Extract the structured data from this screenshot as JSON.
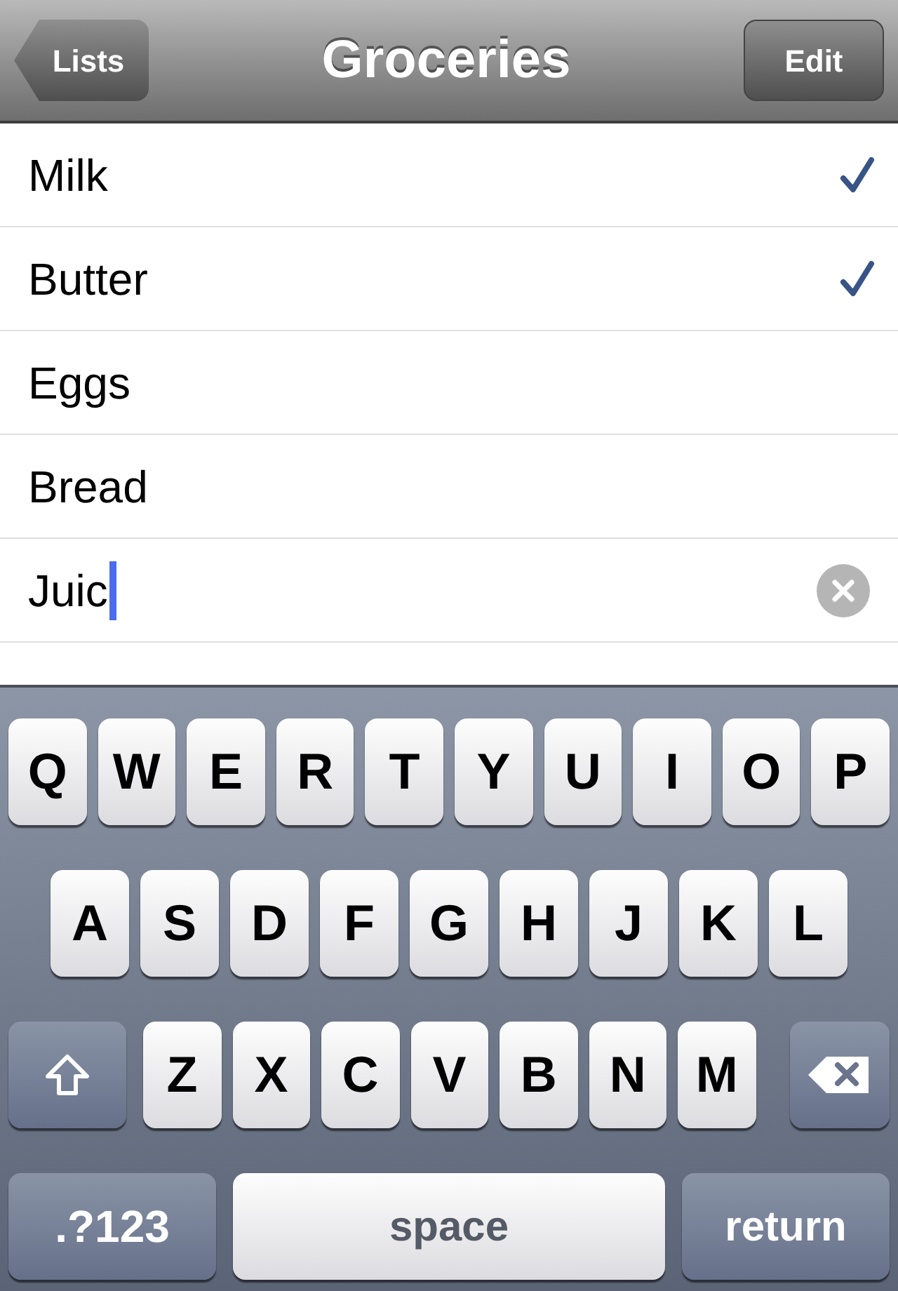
{
  "nav_bar": {
    "back_button": "Lists",
    "title": "Groceries",
    "edit_button": "Edit"
  },
  "items": [
    {
      "kind": "item",
      "text": "Milk",
      "checked": true
    },
    {
      "kind": "item",
      "text": "Butter",
      "checked": true
    },
    {
      "kind": "item",
      "text": "Eggs",
      "checked": false
    },
    {
      "kind": "item",
      "text": "Bread",
      "checked": false
    },
    {
      "kind": "field",
      "value": "Juic"
    }
  ],
  "keyboard": {
    "shift_key": {
      "kind": "shift"
    },
    "delete_key": {
      "kind": "delete"
    },
    "bottom_row": {
      "mode_key": ".?123",
      "space_key": "space",
      "return_key": "return"
    },
    "rows": [
      [
        {
          "kind": "letter",
          "label": "Q"
        },
        {
          "kind": "letter",
          "label": "W"
        },
        {
          "kind": "letter",
          "label": "E"
        },
        {
          "kind": "letter",
          "label": "R"
        },
        {
          "kind": "letter",
          "label": "T"
        },
        {
          "kind": "letter",
          "label": "Y"
        },
        {
          "kind": "letter",
          "label": "U"
        },
        {
          "kind": "letter",
          "label": "I"
        },
        {
          "kind": "letter",
          "label": "O"
        },
        {
          "kind": "letter",
          "label": "P"
        }
      ],
      [
        {
          "kind": "letter",
          "label": "A"
        },
        {
          "kind": "letter",
          "label": "S"
        },
        {
          "kind": "letter",
          "label": "D"
        },
        {
          "kind": "letter",
          "label": "F"
        },
        {
          "kind": "letter",
          "label": "G"
        },
        {
          "kind": "letter",
          "label": "H"
        },
        {
          "kind": "letter",
          "label": "J"
        },
        {
          "kind": "letter",
          "label": "K"
        },
        {
          "kind": "letter",
          "label": "L"
        }
      ],
      [
        {
          "kind": "letter",
          "label": "Z"
        },
        {
          "kind": "letter",
          "label": "X"
        },
        {
          "kind": "letter",
          "label": "C"
        },
        {
          "kind": "letter",
          "label": "V"
        },
        {
          "kind": "letter",
          "label": "B"
        },
        {
          "kind": "letter",
          "label": "N"
        },
        {
          "kind": "letter",
          "label": "M"
        }
      ]
    ]
  }
}
